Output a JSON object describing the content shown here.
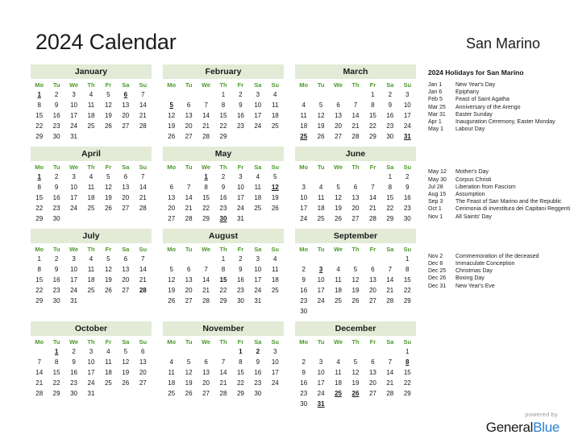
{
  "header": {
    "title": "2024 Calendar",
    "country": "San Marino"
  },
  "weekdays": [
    "Mo",
    "Tu",
    "We",
    "Th",
    "Fr",
    "Sa",
    "Su"
  ],
  "colors": {
    "month_header_bg": "#e3ebd7",
    "weekday_text": "#4c9a2a",
    "holiday_text": "#ee0000",
    "brand_blue": "#2a7fd4"
  },
  "months": [
    {
      "name": "January",
      "lead_blanks": 0,
      "days": 31,
      "holidays": [
        1,
        6
      ],
      "holidays_plain": []
    },
    {
      "name": "February",
      "lead_blanks": 3,
      "days": 29,
      "holidays": [
        5
      ],
      "holidays_plain": []
    },
    {
      "name": "March",
      "lead_blanks": 4,
      "days": 31,
      "holidays": [
        25,
        31
      ],
      "holidays_plain": []
    },
    {
      "name": "April",
      "lead_blanks": 0,
      "days": 30,
      "holidays": [
        1
      ],
      "holidays_plain": []
    },
    {
      "name": "May",
      "lead_blanks": 2,
      "days": 31,
      "holidays": [
        1,
        12,
        30
      ],
      "holidays_plain": []
    },
    {
      "name": "June",
      "lead_blanks": 5,
      "days": 30,
      "holidays": [],
      "holidays_plain": []
    },
    {
      "name": "July",
      "lead_blanks": 0,
      "days": 31,
      "holidays": [],
      "holidays_plain": [
        28
      ]
    },
    {
      "name": "August",
      "lead_blanks": 3,
      "days": 31,
      "holidays": [],
      "holidays_plain": [
        15
      ]
    },
    {
      "name": "September",
      "lead_blanks": 6,
      "days": 30,
      "holidays": [
        3
      ],
      "holidays_plain": []
    },
    {
      "name": "October",
      "lead_blanks": 1,
      "days": 31,
      "holidays": [
        1
      ],
      "holidays_plain": []
    },
    {
      "name": "November",
      "lead_blanks": 4,
      "days": 30,
      "holidays": [],
      "holidays_plain": [
        1,
        2
      ]
    },
    {
      "name": "December",
      "lead_blanks": 6,
      "days": 31,
      "holidays": [
        8,
        25,
        26,
        31
      ],
      "holidays_plain": []
    }
  ],
  "holidays_panel": {
    "heading": "2024 Holidays for San Marino",
    "group1": [
      {
        "date": "Jan 1",
        "name": "New Year's Day"
      },
      {
        "date": "Jan 6",
        "name": "Epiphany"
      },
      {
        "date": "Feb 5",
        "name": "Feast of Saint Agatha"
      },
      {
        "date": "Mar 25",
        "name": "Anniversary of the Arengo"
      },
      {
        "date": "Mar 31",
        "name": "Easter Sunday"
      },
      {
        "date": "Apr 1",
        "name": "Inauguration Ceremony, Easter Monday"
      },
      {
        "date": "May 1",
        "name": "Labour Day"
      }
    ],
    "group2": [
      {
        "date": "May 12",
        "name": "Mother's Day"
      },
      {
        "date": "May 30",
        "name": "Corpus Christi"
      },
      {
        "date": "Jul 28",
        "name": "Liberation from Fascism"
      },
      {
        "date": "Aug 15",
        "name": "Assumption"
      },
      {
        "date": "Sep 3",
        "name": "The Feast of San Marino and the Republic"
      },
      {
        "date": "Oct 1",
        "name": "Cerimonia di investitura dei Capitani Reggenti"
      },
      {
        "date": "Nov 1",
        "name": "All Saints' Day"
      }
    ],
    "group3": [
      {
        "date": "Nov 2",
        "name": "Commemoration of the deceased"
      },
      {
        "date": "Dec 8",
        "name": "Immaculate Conception"
      },
      {
        "date": "Dec 25",
        "name": "Christmas Day"
      },
      {
        "date": "Dec 26",
        "name": "Boxing Day"
      },
      {
        "date": "Dec 31",
        "name": "New Year's Eve"
      }
    ]
  },
  "footer": {
    "powered_by": "powered by",
    "brand_first": "General",
    "brand_second": "Blue"
  }
}
